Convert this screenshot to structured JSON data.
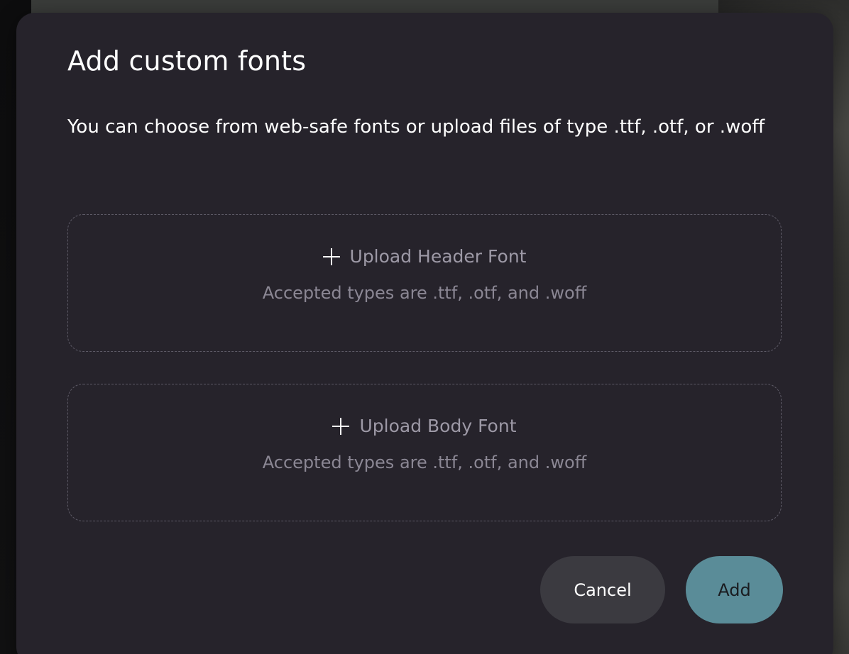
{
  "modal": {
    "title": "Add custom fonts",
    "description": "You can choose from web-safe fonts or upload files of type .ttf, .otf, or .woff"
  },
  "header_upload": {
    "icon": "plus-icon",
    "label": "Upload Header Font",
    "hint": "Accepted types are .ttf, .otf, and .woff"
  },
  "body_upload": {
    "icon": "plus-icon",
    "label": "Upload Body Font",
    "hint": "Accepted types are .ttf, .otf, and .woff"
  },
  "actions": {
    "cancel_label": "Cancel",
    "add_label": "Add"
  },
  "colors": {
    "modal_bg": "#26232b",
    "accent": "#5a8c98",
    "secondary_button": "#3b3a40",
    "muted_text": "#9d99a6"
  }
}
